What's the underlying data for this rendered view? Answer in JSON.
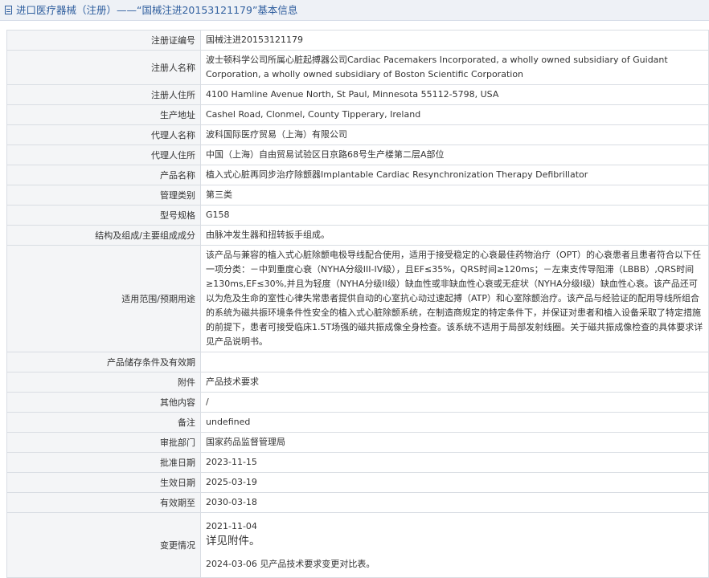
{
  "header": {
    "title": "进口医疗器械（注册）——“国械注进20153121179”基本信息",
    "icon": "document-icon"
  },
  "rows": [
    {
      "label": "注册证编号",
      "value": "国械注进20153121179"
    },
    {
      "label": "注册人名称",
      "value": "波士顿科学公司所属心脏起搏器公司Cardiac Pacemakers Incorporated, a wholly owned subsidiary of Guidant Corporation, a wholly owned subsidiary of Boston Scientific Corporation"
    },
    {
      "label": "注册人住所",
      "value": "4100 Hamline Avenue North, St Paul, Minnesota 55112-5798, USA"
    },
    {
      "label": "生产地址",
      "value": "Cashel Road, Clonmel, County Tipperary, Ireland"
    },
    {
      "label": "代理人名称",
      "value": "波科国际医疗贸易（上海）有限公司"
    },
    {
      "label": "代理人住所",
      "value": "中国（上海）自由贸易试验区日京路68号生产楼第二层A部位"
    },
    {
      "label": "产品名称",
      "value": "植入式心脏再同步治疗除颤器Implantable Cardiac Resynchronization Therapy Defibrillator"
    },
    {
      "label": "管理类别",
      "value": "第三类"
    },
    {
      "label": "型号规格",
      "value": "G158"
    },
    {
      "label": "结构及组成/主要组成成分",
      "value": "由脉冲发生器和扭转扳手组成。"
    },
    {
      "label": "适用范围/预期用途",
      "value": "该产品与兼容的植入式心脏除颤电极导线配合使用，适用于接受稳定的心衰最佳药物治疗（OPT）的心衰患者且患者符合以下任一项分类：－中到重度心衰（NYHA分级III-IV级），且EF≤35%，QRS时间≥120ms；－左束支传导阻滞（LBBB）,QRS时间≥130ms,EF≤30%,并且为轻度（NYHA分级II级）缺血性或非缺血性心衰或无症状（NYHA分级I级）缺血性心衰。该产品还可以为危及生命的室性心律失常患者提供自动的心室抗心动过速起搏（ATP）和心室除颤治疗。该产品与经验证的配用导线所组合的系统为磁共振环境条件性安全的植入式心脏除颤系统，在制造商规定的特定条件下，并保证对患者和植入设备采取了特定措施的前提下，患者可接受临床1.5T场强的磁共振成像全身检查。该系统不适用于局部发射线圈。关于磁共振成像检查的具体要求详见产品说明书。"
    },
    {
      "label": "产品储存条件及有效期",
      "value": ""
    },
    {
      "label": "附件",
      "value": "产品技术要求"
    },
    {
      "label": "其他内容",
      "value": "/"
    },
    {
      "label": "备注",
      "value": "undefined"
    },
    {
      "label": "审批部门",
      "value": "国家药品监督管理局"
    },
    {
      "label": "批准日期",
      "value": "2023-11-15"
    },
    {
      "label": "生效日期",
      "value": "2025-03-19"
    },
    {
      "label": "有效期至",
      "value": "2030-03-18"
    }
  ],
  "change": {
    "label": "变更情况",
    "entries": [
      {
        "date": "2021-11-04",
        "detail": "详见附件。"
      },
      {
        "date": "2024-03-06",
        "detail": "见产品技术要求变更对比表。"
      }
    ]
  }
}
